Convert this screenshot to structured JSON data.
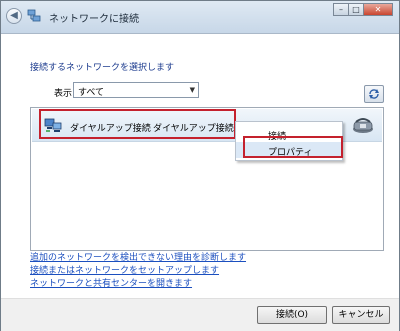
{
  "window": {
    "title": "ネットワークに接続",
    "controls": [
      "minimize",
      "maximize",
      "close"
    ]
  },
  "header": {
    "instruction": "接続するネットワークを選択します"
  },
  "filter": {
    "label": "表示",
    "selected": "すべて"
  },
  "connections": [
    {
      "name": "ダイヤルアップ接続",
      "type": "ダイヤルアップ接続"
    }
  ],
  "context_menu": {
    "items": [
      "接続",
      "プロパティ"
    ],
    "hovered": "プロパティ"
  },
  "links": [
    "追加のネットワークを検出できない理由を診断します",
    "接続またはネットワークをセットアップします",
    "ネットワークと共有センターを開きます"
  ],
  "buttons": {
    "connect": "接続(O)",
    "cancel": "キャンセル"
  },
  "colors": {
    "highlight_border": "#c4212d",
    "link": "#1b4fbf",
    "instruction": "#1c3b8e"
  }
}
